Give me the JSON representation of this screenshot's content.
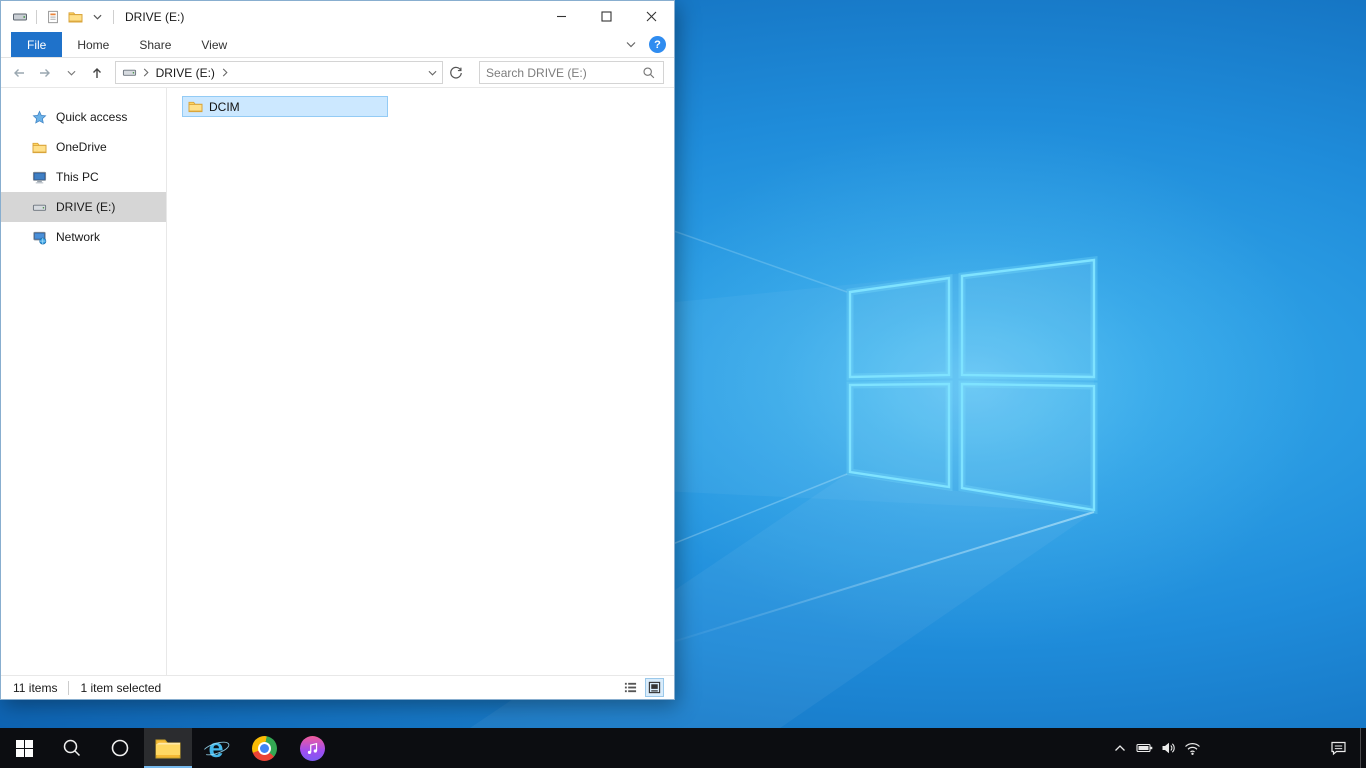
{
  "colors": {
    "file_tab_blue": "#1f72ca",
    "selection_fill": "#cce8ff",
    "selection_border": "#93cbf5",
    "sidebar_selected": "#d6d6d6",
    "taskbar_background": "#0c0d11",
    "wallpaper_center": "#3ab1ef",
    "wallpaper_edge": "#0a4f97",
    "logo_stroke": "#7fe3ff",
    "taskbar_active_underline": "#76b9ed"
  },
  "explorer": {
    "titlebar": {
      "title": "DRIVE (E:)"
    },
    "ribbon": {
      "file_tab": "File",
      "tabs": [
        {
          "label": "Home"
        },
        {
          "label": "Share"
        },
        {
          "label": "View"
        }
      ]
    },
    "addressbar": {
      "path_segment": "DRIVE (E:)",
      "search_placeholder": "Search DRIVE (E:)"
    },
    "sidebar": {
      "items": [
        {
          "label": "Quick access",
          "icon": "star-icon"
        },
        {
          "label": "OneDrive",
          "icon": "onedrive-folder-icon"
        },
        {
          "label": "This PC",
          "icon": "this-pc-icon"
        },
        {
          "label": "DRIVE (E:)",
          "icon": "drive-icon",
          "selected": true
        },
        {
          "label": "Network",
          "icon": "network-icon"
        }
      ]
    },
    "files": [
      {
        "name": "DCIM",
        "icon": "folder-icon",
        "selected": true
      }
    ],
    "statusbar": {
      "items_count": "11 items",
      "selection": "1 item selected"
    }
  },
  "icons": {
    "help_glyph": "?"
  },
  "taskbar": {
    "ie_glyph": "e",
    "buttons": [
      {
        "name": "start",
        "icon": "windows-logo-icon"
      },
      {
        "name": "search",
        "icon": "search-icon"
      },
      {
        "name": "cortana",
        "icon": "cortana-ring-icon"
      },
      {
        "name": "file-explorer",
        "icon": "folder-icon",
        "active": true
      },
      {
        "name": "internet-explorer",
        "icon": "ie-icon"
      },
      {
        "name": "chrome",
        "icon": "chrome-icon"
      },
      {
        "name": "itunes",
        "icon": "itunes-icon"
      }
    ],
    "tray": [
      {
        "name": "hidden-icons",
        "icon": "chevron-up-icon"
      },
      {
        "name": "battery",
        "icon": "battery-icon"
      },
      {
        "name": "volume",
        "icon": "speaker-icon"
      },
      {
        "name": "network",
        "icon": "wifi-icon"
      },
      {
        "name": "action-center",
        "icon": "action-center-icon"
      },
      {
        "name": "show-desktop",
        "icon": "show-desktop-edge"
      }
    ]
  }
}
